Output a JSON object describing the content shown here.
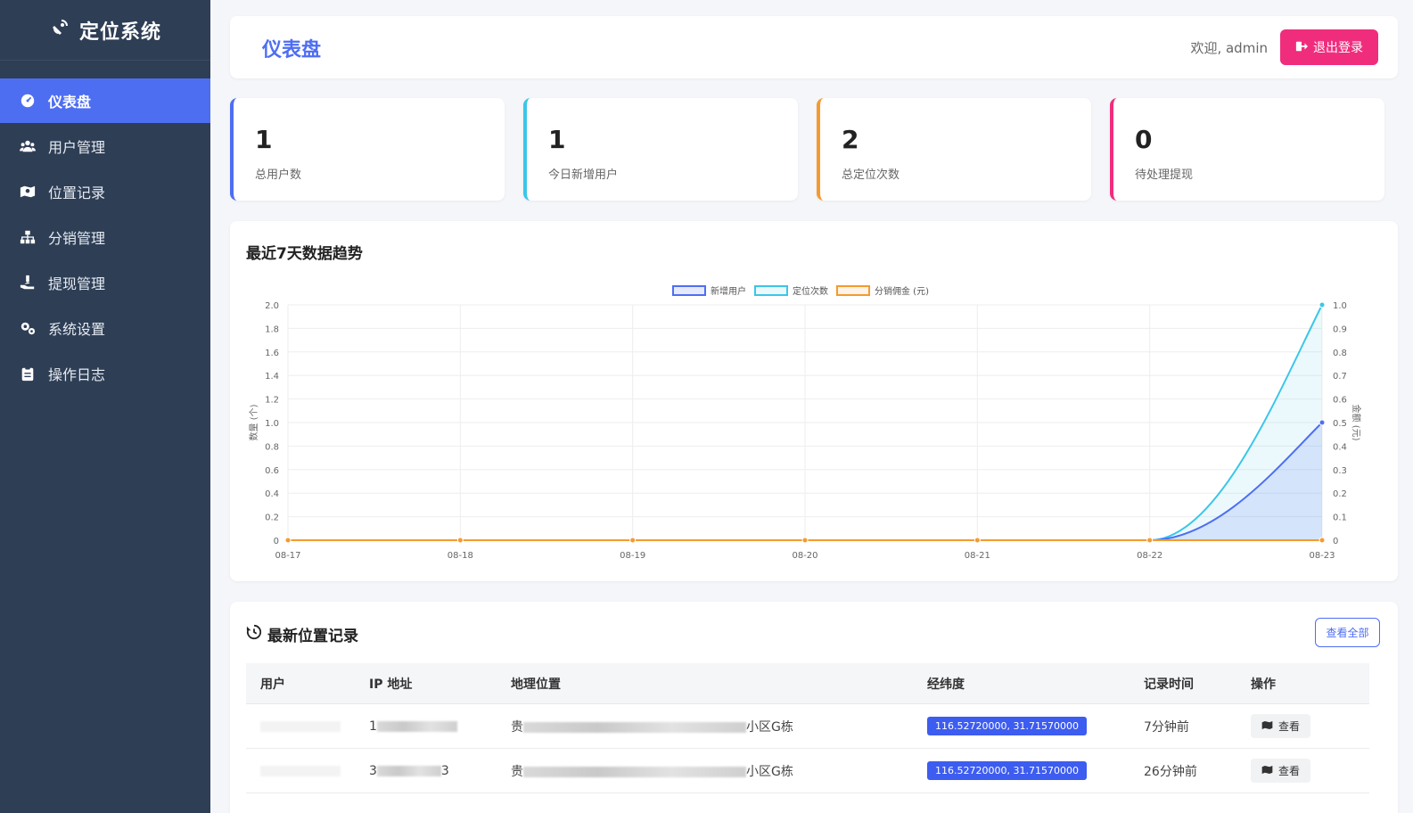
{
  "sidebar": {
    "brand": "定位系统",
    "items": [
      {
        "label": "仪表盘",
        "icon": "dashboard-icon"
      },
      {
        "label": "用户管理",
        "icon": "users-icon"
      },
      {
        "label": "位置记录",
        "icon": "map-icon"
      },
      {
        "label": "分销管理",
        "icon": "sitemap-icon"
      },
      {
        "label": "提现管理",
        "icon": "hand-money-icon"
      },
      {
        "label": "系统设置",
        "icon": "gears-icon"
      },
      {
        "label": "操作日志",
        "icon": "clipboard-icon"
      }
    ]
  },
  "header": {
    "title": "仪表盘",
    "welcome": "欢迎, admin",
    "logout_label": "退出登录"
  },
  "stats": [
    {
      "value": "1",
      "label": "总用户数",
      "color": "#4e6ef2"
    },
    {
      "value": "1",
      "label": "今日新增用户",
      "color": "#3bc6e8"
    },
    {
      "value": "2",
      "label": "总定位次数",
      "color": "#f59a2e"
    },
    {
      "value": "0",
      "label": "待处理提现",
      "color": "#f02d7d"
    }
  ],
  "chart_card": {
    "title": "最近7天数据趋势"
  },
  "chart_data": {
    "type": "line",
    "categories": [
      "08-17",
      "08-18",
      "08-19",
      "08-20",
      "08-21",
      "08-22",
      "08-23"
    ],
    "series": [
      {
        "name": "新增用户",
        "axis": "left",
        "color": "#4e6ef2",
        "fill": "rgba(78,110,242,0.15)",
        "values": [
          0,
          0,
          0,
          0,
          0,
          0,
          1
        ]
      },
      {
        "name": "定位次数",
        "axis": "left",
        "color": "#3bc6e8",
        "fill": "rgba(59,198,232,0.10)",
        "values": [
          0,
          0,
          0,
          0,
          0,
          0,
          2
        ]
      },
      {
        "name": "分销佣金 (元)",
        "axis": "right",
        "color": "#f59a2e",
        "fill": "rgba(245,154,46,0.12)",
        "values": [
          0,
          0,
          0,
          0,
          0,
          0,
          0
        ]
      }
    ],
    "ylabel": "数量 (个)",
    "y2label": "金额 (元)",
    "ylim": [
      0,
      2.0
    ],
    "y2lim": [
      0,
      1.0
    ],
    "yticks": [
      "0",
      "0.2",
      "0.4",
      "0.6",
      "0.8",
      "1.0",
      "1.2",
      "1.4",
      "1.6",
      "1.8",
      "2.0"
    ],
    "y2ticks": [
      "0",
      "0.1",
      "0.2",
      "0.3",
      "0.4",
      "0.5",
      "0.6",
      "0.7",
      "0.8",
      "0.9",
      "1.0"
    ],
    "grid": true,
    "legend": "top-center"
  },
  "records": {
    "title": "最新位置记录",
    "view_all": "查看全部",
    "columns": [
      "用户",
      "IP 地址",
      "地理位置",
      "经纬度",
      "记录时间",
      "操作"
    ],
    "rows": [
      {
        "ip_start": "1",
        "ip_end": "",
        "loc_start": "贵",
        "loc_end": "小区G栋",
        "coord": "116.52720000, 31.71570000",
        "time": "7分钟前",
        "action": "查看"
      },
      {
        "ip_start": "3",
        "ip_end": "3",
        "loc_start": "贵",
        "loc_end": "小区G栋",
        "coord": "116.52720000, 31.71570000",
        "time": "26分钟前",
        "action": "查看"
      }
    ]
  }
}
